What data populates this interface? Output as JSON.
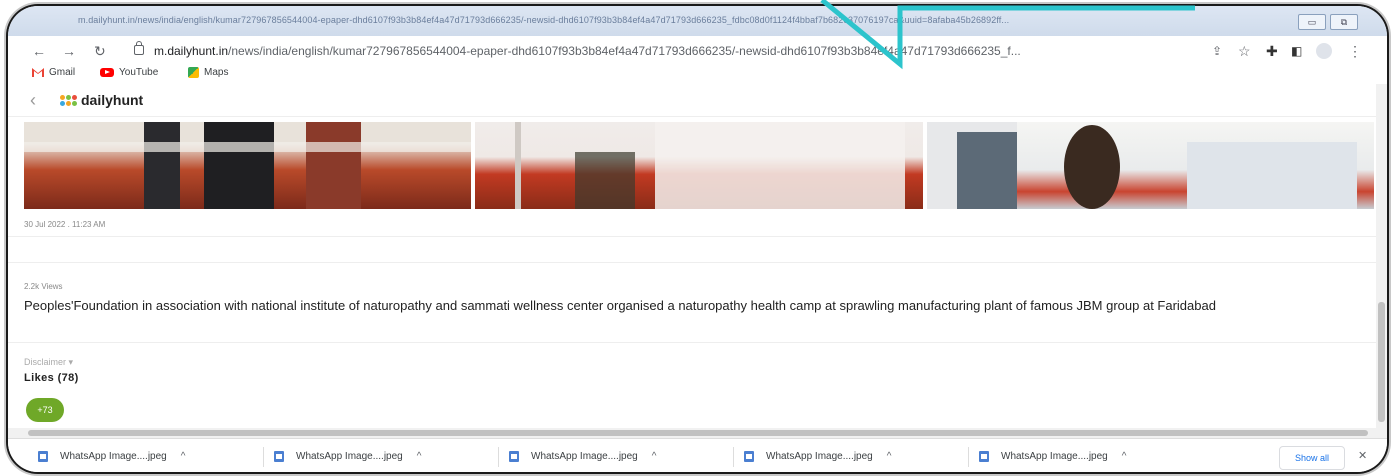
{
  "browser": {
    "title_url": "m.dailyhunt.in/news/india/english/kumar727967856544004-epaper-dhd6107f93b3b84ef4a47d71793d666235/-newsid-dhd6107f93b3b84ef4a47d71793d666235_fdbc08d0f1124f4bbaf7b682c37076197ca&uuid=8afaba45b26892ff...",
    "url_host": "m.dailyhunt.in",
    "url_path": "/news/india/english/kumar727967856544004-epaper-dhd6107f93b3b84ef4a47d71793d666235/-newsid-dhd6107f93b3b84ef4a47d71793d666235_f...",
    "bookmarks": [
      "Gmail",
      "YouTube",
      "Maps"
    ]
  },
  "site": {
    "logo_text": "dailyhunt"
  },
  "article": {
    "datetime": "30 Jul 2022 . 11:23 AM",
    "views": "2.2k Views",
    "description": "Peoples'Foundation in association with national institute of naturopathy and sammati wellness center organised a naturopathy health camp at sprawling manufacturing plant of famous JBM group at Faridabad",
    "disclaimer": "Disclaimer ▾",
    "likes_label": "Likes (78)",
    "likes_bubble": "+73"
  },
  "downloads": {
    "items": [
      "WhatsApp Image....jpeg",
      "WhatsApp Image....jpeg",
      "WhatsApp Image....jpeg",
      "WhatsApp Image....jpeg",
      "WhatsApp Image....jpeg"
    ],
    "show_all": "Show all"
  },
  "colors": {
    "annotation": "#2cc4cc",
    "likes_green": "#6fa828",
    "link_blue": "#1a73e8"
  }
}
